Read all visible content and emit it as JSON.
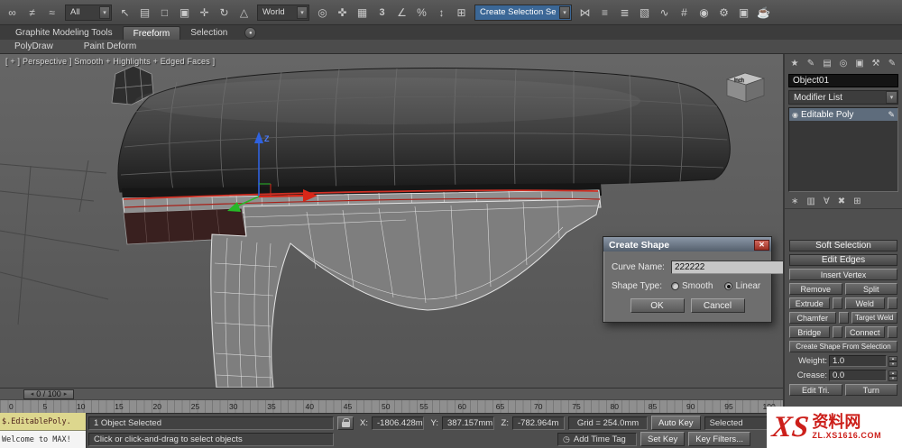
{
  "colors": {
    "accent_blue": "#3b6796",
    "selection_red": "#d03024",
    "watermark_red": "#cc1f1a"
  },
  "icons": {
    "link": "∞",
    "unlink": "≠",
    "bind": "≈",
    "select": "↖",
    "select_by_name": "▤",
    "region": "□",
    "window_crossing": "▣",
    "move": "✛",
    "rotate": "↻",
    "scale": "△",
    "center": "◎",
    "manipulate": "✜",
    "keyboard": "▦",
    "snap3": "3",
    "angle_snap": "∠",
    "percent_snap": "%",
    "spinner_snap": "↕",
    "named_sets": "⊞",
    "mirror": "⋈",
    "align": "≡",
    "layers": "≣",
    "graphite": "▧",
    "curve_editor": "∿",
    "schematic": "#",
    "material": "◉",
    "render_setup": "⚙",
    "rendered_frame": "▣",
    "render": "☕",
    "dropdown_arrow": "▾",
    "ribbon_circle": "●",
    "tab_create": "★",
    "tab_modify": "✎",
    "tab_hierarchy": "▤",
    "tab_motion": "◎",
    "tab_display": "▣",
    "tab_utilities": "⚒",
    "pencil": "✎",
    "stack_bulb": "◉",
    "pin": "∗",
    "show_end": "▥",
    "unique": "∀",
    "remove_mod": "✖",
    "configure": "⊞",
    "clock": "◷",
    "spin_up": "▴",
    "spin_down": "▾",
    "slider_left": "◂",
    "slider_right": "▸",
    "close": "✕"
  },
  "toolbar": {
    "filter_dropdown": "All",
    "coord_dropdown": "World",
    "selset_dropdown": "Create Selection Se"
  },
  "ribbon": {
    "tab_graphite": "Graphite Modeling Tools",
    "tab_freeform": "Freeform",
    "tab_selection": "Selection",
    "sub_polydraw": "PolyDraw",
    "sub_paintdeform": "Paint Deform"
  },
  "viewport": {
    "label": "[ + ] Perspective ] Smooth + Highlights + Edged Faces ]",
    "gizmo_axis_z": "Z",
    "cube_label": "inch"
  },
  "dialog": {
    "title": "Create Shape",
    "curve_name_label": "Curve Name:",
    "curve_name_value": "222222",
    "shape_type_label": "Shape Type:",
    "radio_smooth": "Smooth",
    "radio_linear": "Linear",
    "ok_label": "OK",
    "cancel_label": "Cancel"
  },
  "command_panel": {
    "object_name": "Object01",
    "modifier_list_label": "Modifier List",
    "stack_items": [
      {
        "label": "Editable Poly"
      }
    ],
    "rollout_soft_selection": "Soft Selection",
    "rollout_edit_edges": "Edit Edges",
    "btn_insert_vertex": "Insert Vertex",
    "btn_remove": "Remove",
    "btn_split": "Split",
    "btn_extrude": "Extrude",
    "btn_weld": "Weld",
    "btn_chamfer": "Chamfer",
    "btn_target_weld": "Target Weld",
    "btn_bridge": "Bridge",
    "btn_connect": "Connect",
    "btn_create_shape": "Create Shape From Selection",
    "weight_label": "Weight:",
    "weight_value": "1.0",
    "crease_label": "Crease:",
    "crease_value": "0.0",
    "btn_edit_tri": "Edit Tri.",
    "btn_turn": "Turn"
  },
  "timeline": {
    "slider_label": "0 / 100",
    "ticks": [
      "0",
      "5",
      "10",
      "15",
      "20",
      "25",
      "30",
      "35",
      "40",
      "45",
      "50",
      "55",
      "60",
      "65",
      "70",
      "75",
      "80",
      "85",
      "90",
      "95",
      "100"
    ]
  },
  "status": {
    "object_selected": "1 Object Selected",
    "prompt": "Click or click-and-drag to select objects",
    "x_label": "X:",
    "x_value": "-1806.428m",
    "y_label": "Y:",
    "y_value": "387.157mm",
    "z_label": "Z:",
    "z_value": "-782.964m",
    "grid_label": "Grid = 254.0mm",
    "add_time_tag": "Add Time Tag",
    "auto_key": "Auto Key",
    "selected_dropdown": "Selected",
    "set_key": "Set Key",
    "key_filters": "Key Filters..."
  },
  "maxscript": {
    "line1": "$.EditablePoly.",
    "line2": "Welcome to MAX!"
  },
  "watermark": {
    "xs": "XS",
    "name": "资料网",
    "url": "ZL.XS1616.COM"
  }
}
